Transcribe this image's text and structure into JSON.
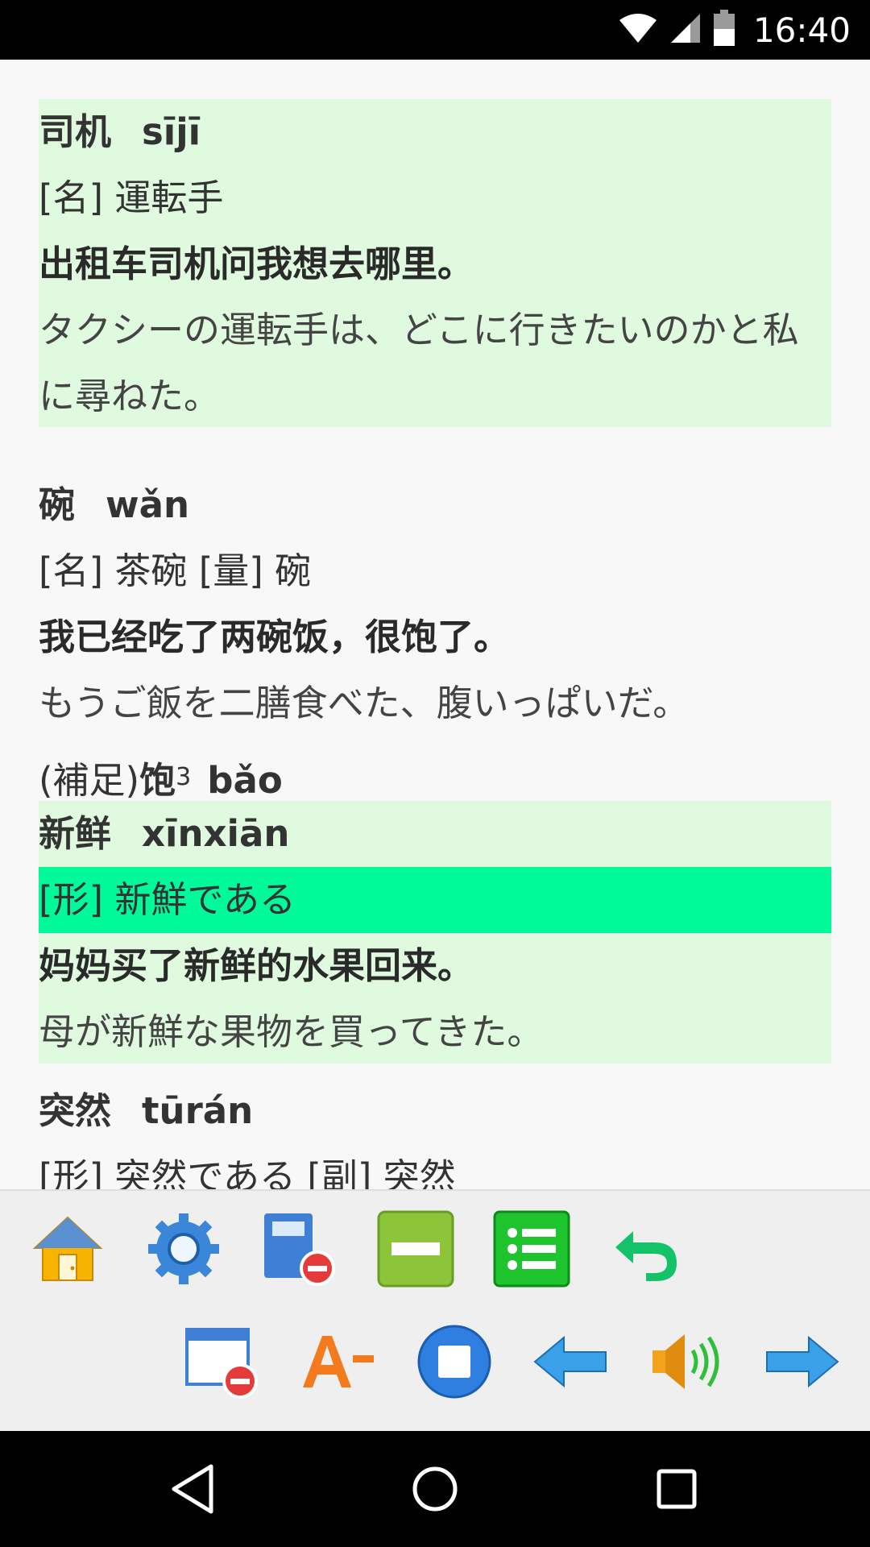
{
  "status_bar": {
    "time": "16:40",
    "icons": [
      "wifi-icon",
      "signal-icon",
      "battery-icon"
    ]
  },
  "entries": [
    {
      "word": "司机",
      "pinyin": "sījī",
      "definition": "[名] 運転手",
      "example": "出租车司机问我想去哪里。",
      "translation": "タクシーの運転手は、どこに行きたいのかと私に尋ねた。",
      "highlighted": true
    },
    {
      "word": "碗",
      "pinyin": "wǎn",
      "definition": "[名] 茶碗 [量] 碗",
      "example": "我已经吃了两碗饭，很饱了。",
      "translation": "もうご飯を二膳食べた、腹いっぱいだ。",
      "note_prefix": "(補足)",
      "note_word": "饱",
      "note_sup": "3",
      "note_pinyin": "bǎo",
      "highlighted": false
    },
    {
      "word": "新鲜",
      "pinyin": "xīnxiān",
      "definition": "[形] 新鮮である",
      "example": "妈妈买了新鲜的水果回来。",
      "translation": "母が新鮮な果物を買ってきた。",
      "highlighted": true,
      "definition_selected": true
    },
    {
      "word": "突然",
      "pinyin": "tūrán",
      "definition": "[形] 突然である [副] 突然",
      "highlighted": false
    }
  ],
  "toolbar": {
    "row1": [
      "home-icon",
      "settings-icon",
      "book-remove-icon",
      "minus-icon",
      "list-icon",
      "undo-icon"
    ],
    "row2": [
      "window-remove-icon",
      "font-decrease-icon",
      "stop-icon",
      "back-arrow-icon",
      "speaker-icon",
      "forward-arrow-icon"
    ]
  },
  "colors": {
    "entry_highlight": "#e0fae0",
    "selected_line": "#00fa9a",
    "toolbar_bg": "#efefef"
  }
}
